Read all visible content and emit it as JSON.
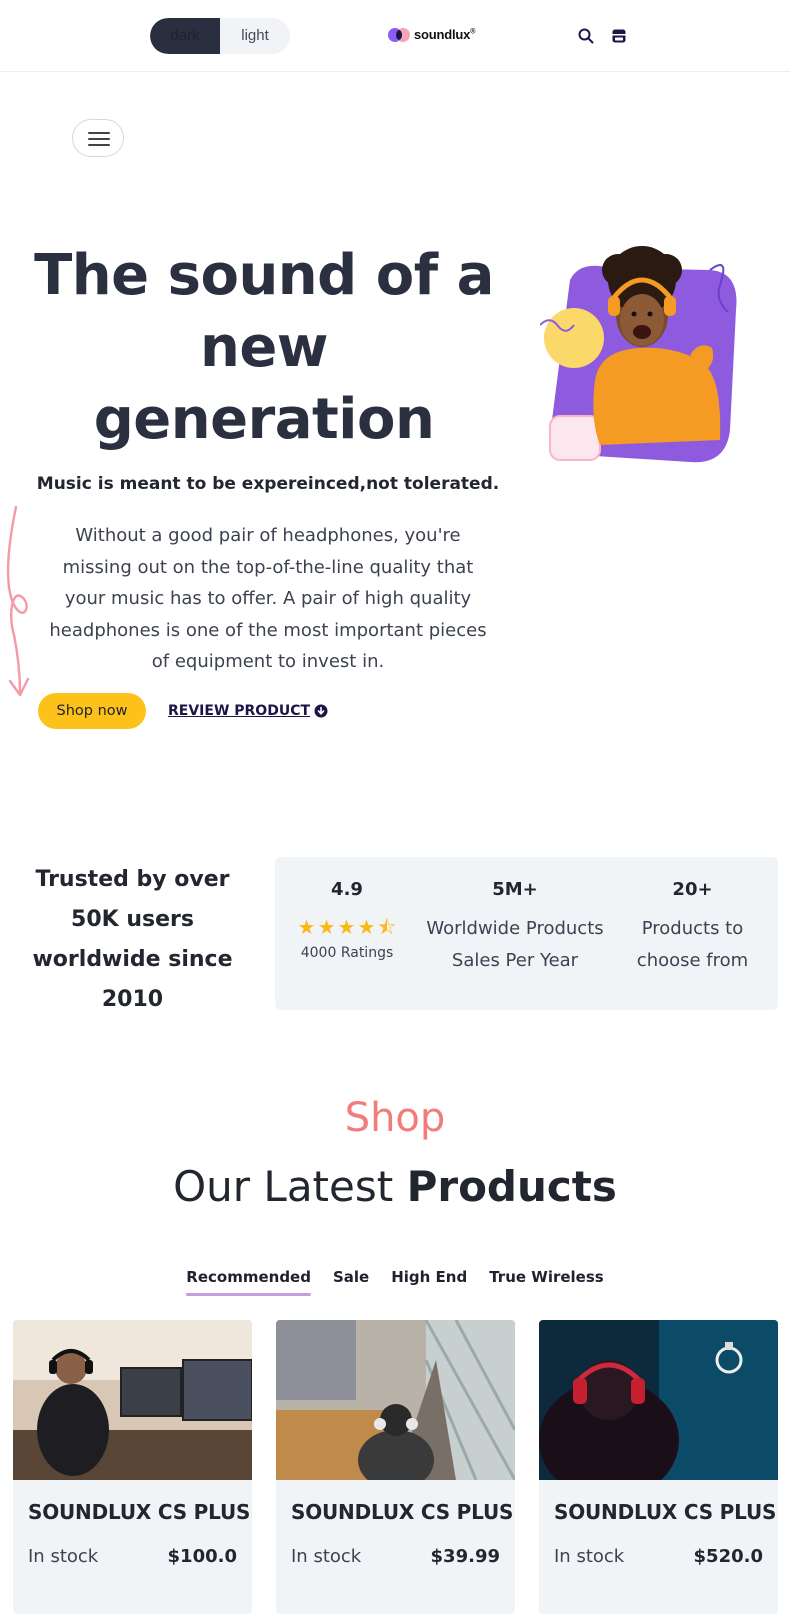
{
  "header": {
    "theme_toggle": {
      "dark_label": "dark",
      "light_label": "light",
      "selected": "dark"
    },
    "logo_text": "soundlux",
    "icons": [
      "search-icon",
      "store-icon"
    ]
  },
  "hero": {
    "title": "The sound of a new generation",
    "subtitle": "Music is meant to be expereinced,not tolerated.",
    "description": "Without a good pair of headphones, you're missing out on the top-of-the-line quality that your music has to offer. A pair of high quality headphones is one of the most important pieces of equipment to invest in.",
    "shop_button": "Shop now",
    "review_link": "REVIEW PRODUCT"
  },
  "stats": {
    "trusted_text": "Trusted by over 50K users worldwide since 2010",
    "items": [
      {
        "value": "4.9",
        "rating": 4.5,
        "label": "4000 Ratings"
      },
      {
        "value": "5M+",
        "label": "Worldwide Products Sales Per Year"
      },
      {
        "value": "20+",
        "label": "Products to choose from"
      }
    ]
  },
  "shop": {
    "eyebrow": "Shop",
    "heading_regular": "Our Latest ",
    "heading_bold": "Products",
    "tabs": [
      {
        "label": "Recommended",
        "active": true
      },
      {
        "label": "Sale"
      },
      {
        "label": "High End"
      },
      {
        "label": "True Wireless"
      }
    ],
    "products": [
      {
        "name": "SOUNDLUX CS PLUS",
        "stock": "In stock",
        "price": "$100.0"
      },
      {
        "name": "SOUNDLUX CS PLUS",
        "stock": "In stock",
        "price": "$39.99"
      },
      {
        "name": "SOUNDLUX CS PLUS",
        "stock": "In stock",
        "price": "$520.0"
      }
    ]
  },
  "colors": {
    "accent_yellow": "#fcc21a",
    "shop_pink": "#f27c7c",
    "dark_navy": "#2a2f40",
    "tab_underline": "#c89ce0",
    "hero_purple": "#8b5cf6"
  }
}
